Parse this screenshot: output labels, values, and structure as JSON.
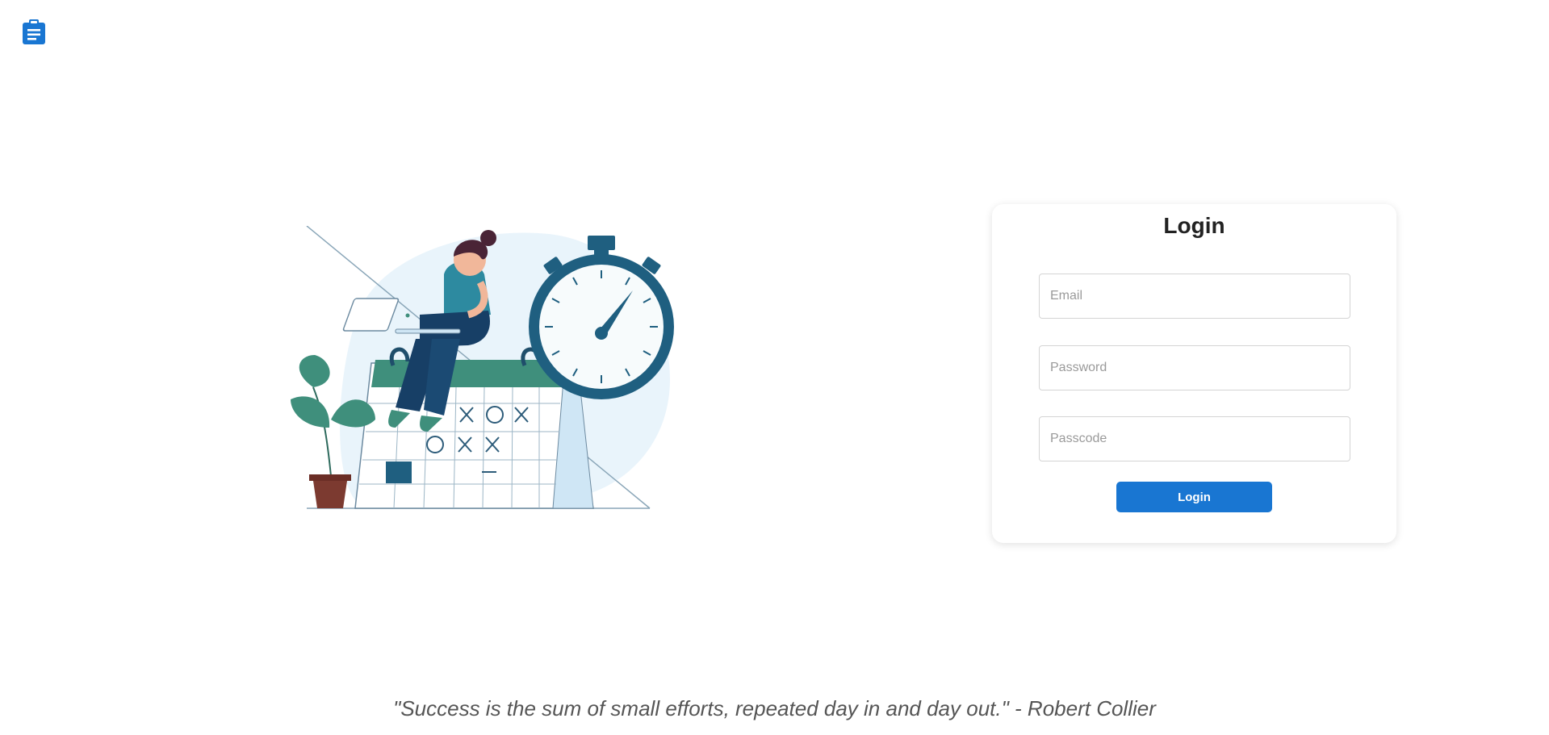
{
  "app": {
    "logo_icon": "clipboard-icon",
    "brand_color": "#1976d2"
  },
  "illustration": {
    "subject": "woman-with-laptop-on-calendar-with-stopwatch"
  },
  "login": {
    "title": "Login",
    "email_placeholder": "Email",
    "password_placeholder": "Password",
    "passcode_placeholder": "Passcode",
    "button_label": "Login"
  },
  "footer": {
    "quote": "\"Success is the sum of small efforts, repeated day in and day out.\" - Robert Collier"
  }
}
